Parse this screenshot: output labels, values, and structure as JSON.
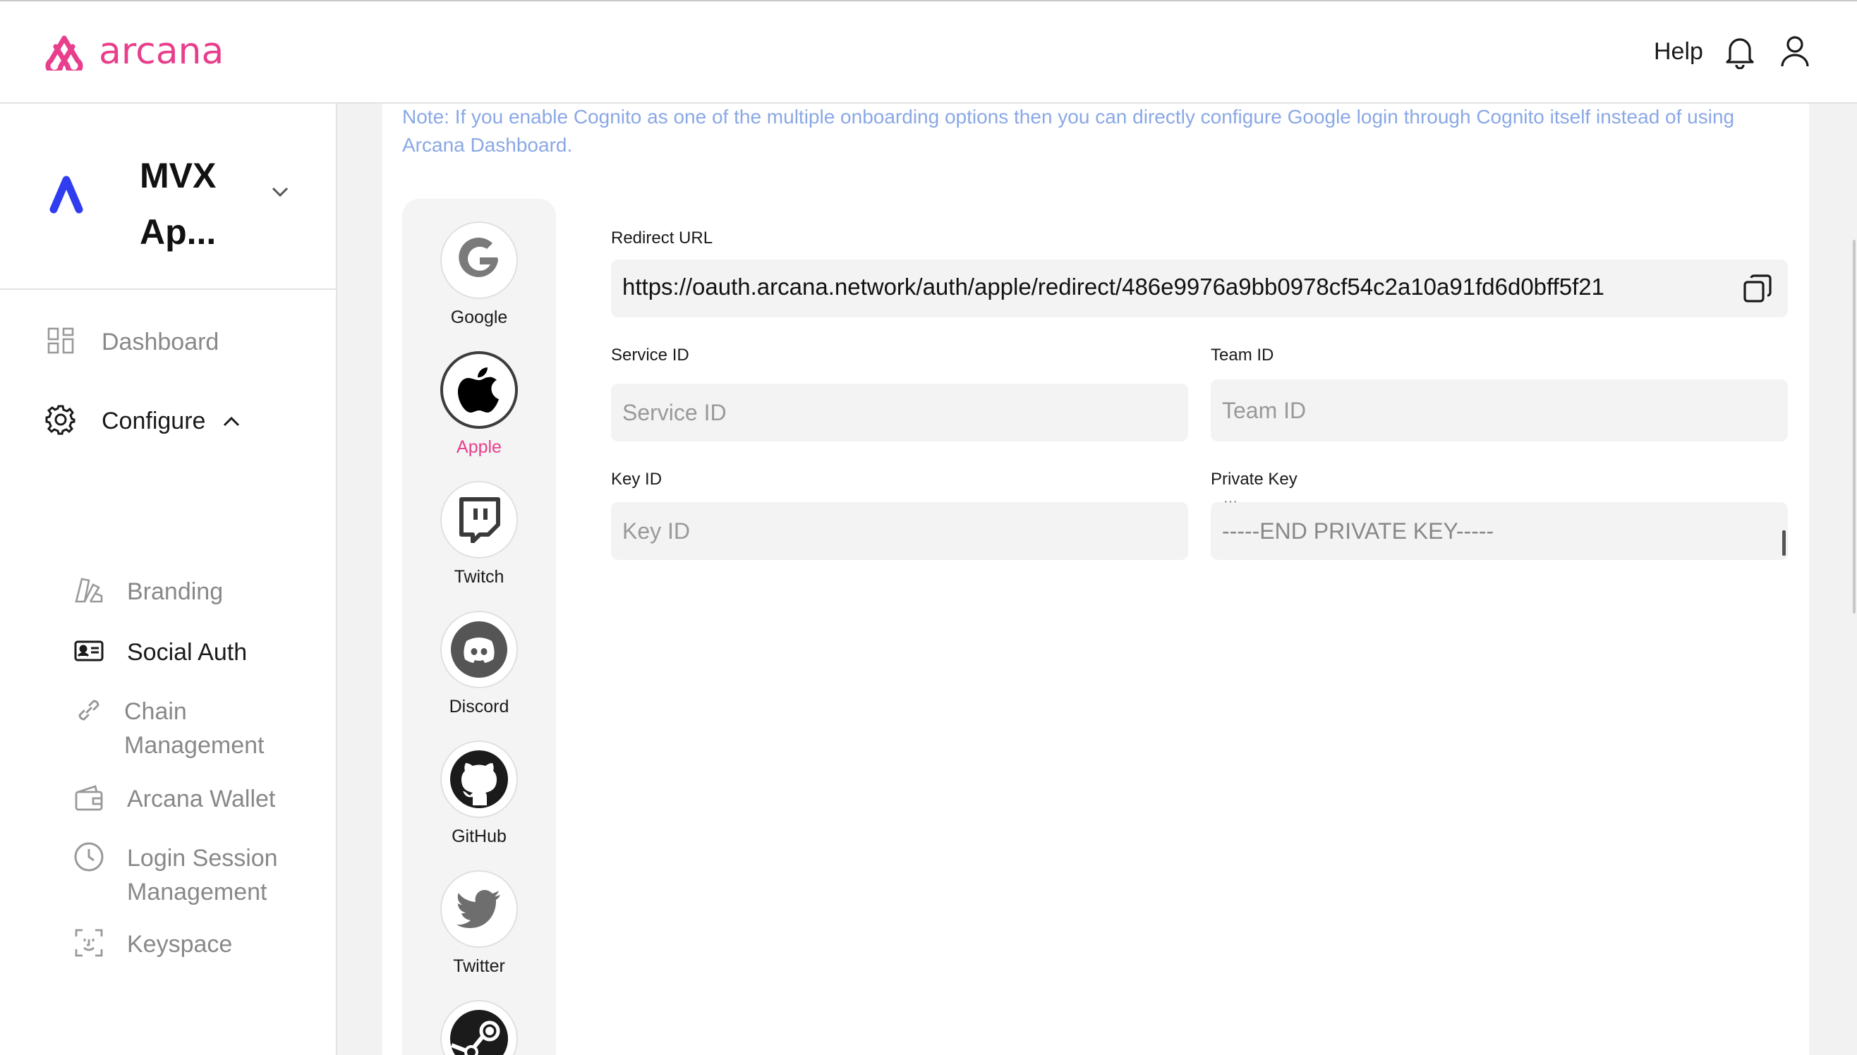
{
  "header": {
    "logo_text": "arcana",
    "help_label": "Help",
    "brand_color": "#e83e8c"
  },
  "sidebar": {
    "app_name": "MVX Ap...",
    "items": [
      {
        "label": "Dashboard",
        "icon": "dashboard-icon"
      },
      {
        "label": "Configure",
        "icon": "gear-icon",
        "expanded": true
      },
      {
        "label": "Branding",
        "icon": "palette-icon"
      },
      {
        "label": "Social Auth",
        "icon": "id-card-icon",
        "selected": true
      },
      {
        "label": "Chain Management",
        "icon": "link-icon"
      },
      {
        "label": "Arcana Wallet",
        "icon": "wallet-icon"
      },
      {
        "label": "Login Session Management",
        "icon": "clock-icon"
      },
      {
        "label": "Keyspace",
        "icon": "face-scan-icon"
      }
    ]
  },
  "main": {
    "note": "Note: If you enable Cognito as one of the multiple onboarding options then you can directly configure Google login through Cognito itself instead of using Arcana Dashboard.",
    "providers": [
      {
        "label": "Google",
        "icon": "google-icon"
      },
      {
        "label": "Apple",
        "icon": "apple-icon",
        "active": true
      },
      {
        "label": "Twitch",
        "icon": "twitch-icon"
      },
      {
        "label": "Discord",
        "icon": "discord-icon"
      },
      {
        "label": "GitHub",
        "icon": "github-icon"
      },
      {
        "label": "Twitter",
        "icon": "twitter-icon"
      },
      {
        "label": "",
        "icon": "steam-icon"
      }
    ],
    "form": {
      "redirect_label": "Redirect URL",
      "redirect_value": "https://oauth.arcana.network/auth/apple/redirect/486e9976a9bb0978cf54c2a10a91fd6d0bff5f21",
      "service_id_label": "Service ID",
      "service_id_placeholder": "Service ID",
      "team_id_label": "Team ID",
      "team_id_placeholder": "Team ID",
      "key_id_label": "Key ID",
      "key_id_placeholder": "Key ID",
      "private_key_label": "Private Key",
      "private_key_value": "-----END PRIVATE KEY-----"
    }
  }
}
